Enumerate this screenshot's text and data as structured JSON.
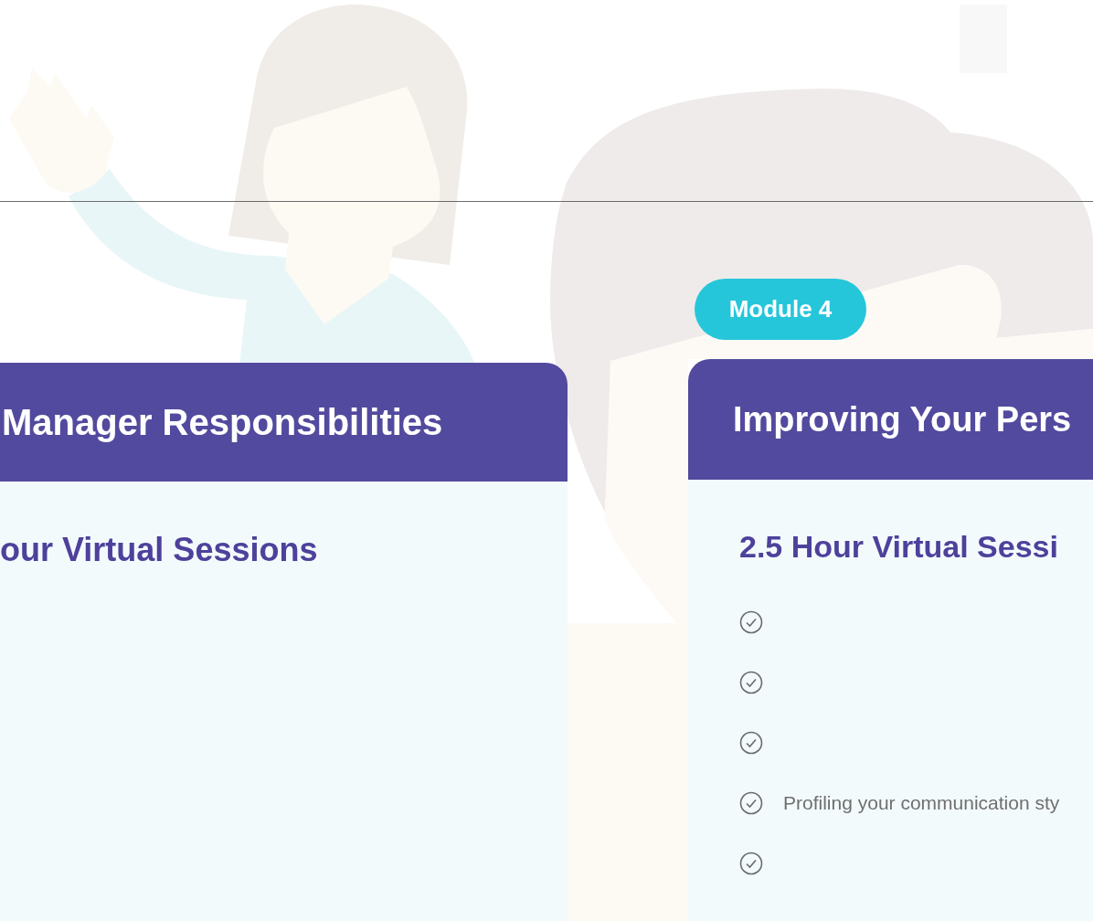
{
  "left_card": {
    "title": "Manager Responsibilities",
    "subtitle": "our Virtual Sessions"
  },
  "right_card": {
    "badge": "Module 4",
    "title": "Improving Your Pers",
    "subtitle": "2.5 Hour Virtual Sessi",
    "items": [
      {
        "kind": "check"
      },
      {
        "kind": "check"
      },
      {
        "kind": "check"
      },
      {
        "kind": "check",
        "text": "Profiling your communication sty"
      },
      {
        "kind": "check"
      }
    ]
  }
}
